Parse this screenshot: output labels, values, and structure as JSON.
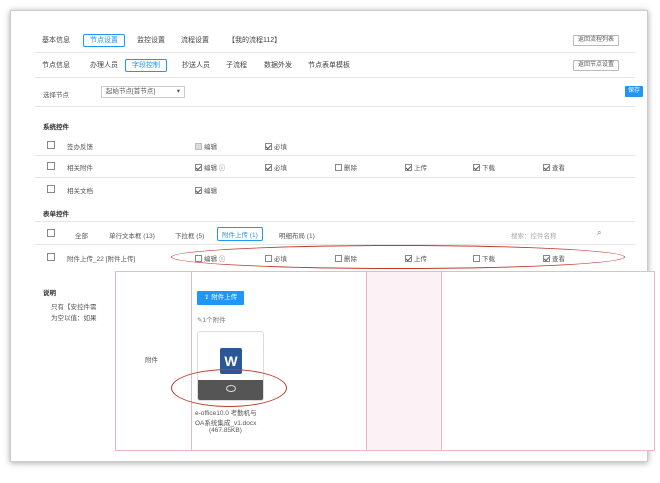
{
  "top_tabs": [
    "基本信息",
    "节点设置",
    "监控设置",
    "流程设置",
    "【我的流程112】"
  ],
  "top_right_button": "返回流程列表",
  "node_tabs": [
    "节点信息",
    "办理人员",
    "字段控制",
    "抄送人员",
    "子流程",
    "数据外发",
    "节点表单模板"
  ],
  "node_right_button": "返回节点设置",
  "select_node": {
    "label": "选择节点",
    "value": "起始节点[首节点]"
  },
  "save_label": "保存",
  "system_controls": {
    "title": "系统控件",
    "rows": [
      {
        "name": "签办反馈",
        "opts": [
          {
            "label": "编辑",
            "state": "gray"
          },
          {
            "label": "必填",
            "state": "on"
          }
        ]
      },
      {
        "name": "相关附件",
        "opts": [
          {
            "label": "编辑 ⓘ",
            "state": "on"
          },
          {
            "label": "必填",
            "state": "on"
          },
          {
            "label": "删除",
            "state": "off"
          },
          {
            "label": "上传",
            "state": "on"
          },
          {
            "label": "下载",
            "state": "on"
          },
          {
            "label": "查看",
            "state": "on"
          }
        ]
      },
      {
        "name": "相关文档",
        "opts": [
          {
            "label": "编辑",
            "state": "on"
          }
        ]
      }
    ]
  },
  "form_controls": {
    "title": "表单控件",
    "subtabs": [
      "全部",
      "单行文本框 (13)",
      "下拉框 (5)",
      "附件上传 (1)",
      "明细布局 (1)"
    ],
    "search_placeholder": "搜索：控件名称",
    "row": {
      "name": "附件上传_22 [附件上传]",
      "opts": [
        {
          "label": "编辑 ⓘ",
          "state": "off"
        },
        {
          "label": "必填",
          "state": "off"
        },
        {
          "label": "删除",
          "state": "off"
        },
        {
          "label": "上传",
          "state": "on"
        },
        {
          "label": "下载",
          "state": "off"
        },
        {
          "label": "查看",
          "state": "on"
        }
      ]
    }
  },
  "note": {
    "title": "说明",
    "lines": [
      "只有【安控件需",
      "为空以值：如果"
    ]
  },
  "preview": {
    "row_label": "附件",
    "upload_button": "附件上传",
    "count_text": "1个附件",
    "file_icon_letter": "W",
    "file_name_lines": [
      "e-office10.0 考勤机与",
      "OA系统集成_v1.docx",
      "(467.85KB)"
    ]
  },
  "colors": {
    "accent": "#2196f3",
    "highlight": "#c0392b",
    "word": "#2b5797",
    "pink_border": "#f0b6c4"
  }
}
